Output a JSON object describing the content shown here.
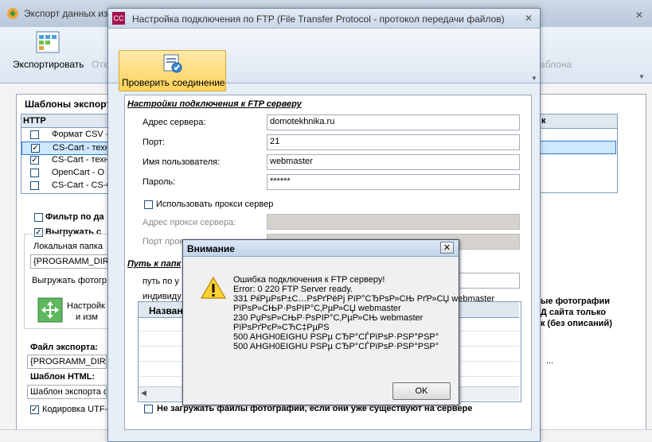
{
  "bg_window": {
    "title": "Экспорт данных из",
    "ribbon": {
      "export_label": "Экспортировать",
      "other_label": "Отк",
      "right_label": "аблона"
    },
    "templates_title": "Шаблоны экспорт",
    "grid_header_http": "HTTP",
    "grid_right_header": "к",
    "template_rows": [
      {
        "checked": false,
        "label": "Формат CSV -"
      },
      {
        "checked": true,
        "label": "CS-Cart - техн"
      },
      {
        "checked": true,
        "label": "CS-Cart - техн"
      },
      {
        "checked": false,
        "label": "OpenCart - O"
      },
      {
        "checked": false,
        "label": "CS-Cart - CS-C"
      }
    ],
    "filter_label": "Фильтр по да",
    "upload_label": "Выгружать с",
    "local_folder_label": "Локальная папка",
    "local_folder_value": "{PROGRAMM_DIR}",
    "upload_photos_label": "Выгружать фотогр",
    "setup_line1": "Настройк",
    "setup_line2": "и изм",
    "export_file_label": "Файл экспорта:",
    "export_file_value": "{PROGRAMM_DIR}\\",
    "html_template_label": "Шаблон HTML:",
    "html_template_value": "Шаблон экспорта о",
    "encoding_label": "Кодировка UTF-",
    "right_text1": "ые фотографии",
    "right_text2": "Д сайта только",
    "right_text3": "к (без описаний)",
    "ellipsis": "..."
  },
  "ftp_window": {
    "title": "Настройка подключения по FTP (File Transfer Protocol - протокол передачи файлов)",
    "verify_button_label": "Проверить соединение",
    "section_title": "Настройки подключения к FTP серверу",
    "server_label": "Адрес сервера:",
    "server_value": "domotekhnika.ru",
    "port_label": "Порт:",
    "port_value": "21",
    "user_label": "Имя пользователя:",
    "user_value": "webmaster",
    "password_label": "Пароль:",
    "password_value": "******",
    "use_proxy_label": "Использовать прокси сервер",
    "proxy_address_label": "Адрес прокси сервера:",
    "proxy_port_label": "Порт прокс",
    "path_section_title": "Путь к папк",
    "path_label": "путь по у",
    "individual_label": "индивиду",
    "grid_header": "Назван",
    "no_upload_label": "Не загружать файлы фотографий, если они уже существуют на сервере"
  },
  "dialog": {
    "title": "Внимание",
    "close_label": "✕",
    "message_lines": [
      "Ошибка подключения к FTP серверу!",
      "Error: 0 220 FTP Server ready.",
      "331 РќРµРѕР±С…РѕРґРёРј РїР°СЂРѕР»СЊ РґР»СЏ webmaster",
      "РїРѕР»СЊР·РѕРІР°С‚РµР»СЏ webmaster",
      "230 РџРѕР»СЊР·РѕРІР°С‚РµР»СЊ webmaster",
      "РїРѕРґРєР»СЋС‡РµРЅ",
      "500 AHGH0EIGHU РЅРµ СЂР°СЃРїРѕР·РЅР°РЅР°",
      "500 AHGH0EIGHU РЅРµ СЂР°СЃРїРѕР·РЅР°РЅР°"
    ],
    "ok_label": "OK"
  },
  "colors": {
    "accent": "#fdd25a",
    "selection": "#cde8ff",
    "title_bar": "#c9d7e8"
  }
}
